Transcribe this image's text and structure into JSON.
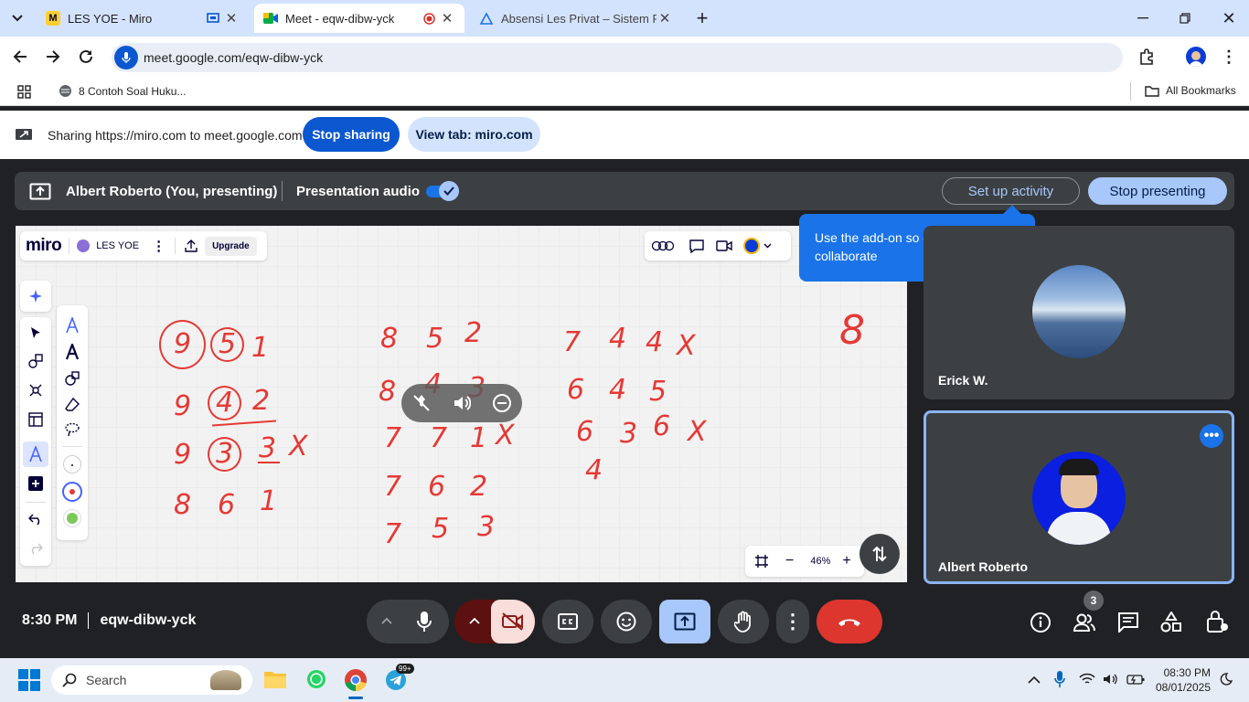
{
  "browser": {
    "tabs": [
      {
        "title": "LES YOE - Miro"
      },
      {
        "title": "Meet - eqw-dibw-yck"
      },
      {
        "title": "Absensi Les Privat – Sistem Ruang"
      }
    ],
    "url": "meet.google.com/eqw-dibw-yck",
    "bookmark": "8 Contoh Soal Huku...",
    "all_bookmarks": "All Bookmarks"
  },
  "share_bar": {
    "text": "Sharing https://miro.com to meet.google.com",
    "stop_sharing": "Stop sharing",
    "view_tab": "View tab: miro.com"
  },
  "present_bar": {
    "presenter": "Albert Roberto (You, presenting)",
    "audio_label": "Presentation audio",
    "setup_activity": "Set up activity",
    "stop_presenting": "Stop presenting"
  },
  "tooltip": {
    "text": "Use the add-on so others can collaborate"
  },
  "miro": {
    "logo": "miro",
    "board_name": "LES YOE",
    "upgrade": "Upgrade",
    "zoom": "46%",
    "handwriting": [
      {
        "text": "9",
        "circled": true
      },
      {
        "text": "5",
        "circled": true
      },
      {
        "text": "1"
      },
      {
        "text": "9"
      },
      {
        "text": "4",
        "circled": true
      },
      {
        "text": "2"
      },
      {
        "text": "9"
      },
      {
        "text": "3",
        "circled": true
      },
      {
        "text": "3"
      },
      {
        "text": "X"
      },
      {
        "text": "8"
      },
      {
        "text": "6"
      },
      {
        "text": "1"
      },
      {
        "text": "8"
      },
      {
        "text": "5"
      },
      {
        "text": "2"
      },
      {
        "text": "8"
      },
      {
        "text": "4"
      },
      {
        "text": "3"
      },
      {
        "text": "7"
      },
      {
        "text": "7"
      },
      {
        "text": "1"
      },
      {
        "text": "X"
      },
      {
        "text": "7"
      },
      {
        "text": "6"
      },
      {
        "text": "2"
      },
      {
        "text": "7"
      },
      {
        "text": "5"
      },
      {
        "text": "3"
      },
      {
        "text": "7"
      },
      {
        "text": "4"
      },
      {
        "text": "4"
      },
      {
        "text": "X"
      },
      {
        "text": "6"
      },
      {
        "text": "4"
      },
      {
        "text": "5"
      },
      {
        "text": "6"
      },
      {
        "text": "3"
      },
      {
        "text": "6"
      },
      {
        "text": "X"
      },
      {
        "text": "4"
      },
      {
        "text": "8"
      }
    ],
    "ink_color": "#e53935"
  },
  "participants": [
    {
      "name": "Erick W."
    },
    {
      "name": "Albert Roberto"
    }
  ],
  "bottom": {
    "time": "8:30 PM",
    "meeting_code": "eqw-dibw-yck",
    "people_count": "3"
  },
  "taskbar": {
    "search": "Search",
    "time": "08:30 PM",
    "date": "08/01/2025",
    "telegram_badge": "99+"
  },
  "colors": {
    "accent": "#0b57d0",
    "light_blue": "#a8c7fa",
    "end_call": "#dc362e",
    "tooltip": "#1a73e8"
  }
}
